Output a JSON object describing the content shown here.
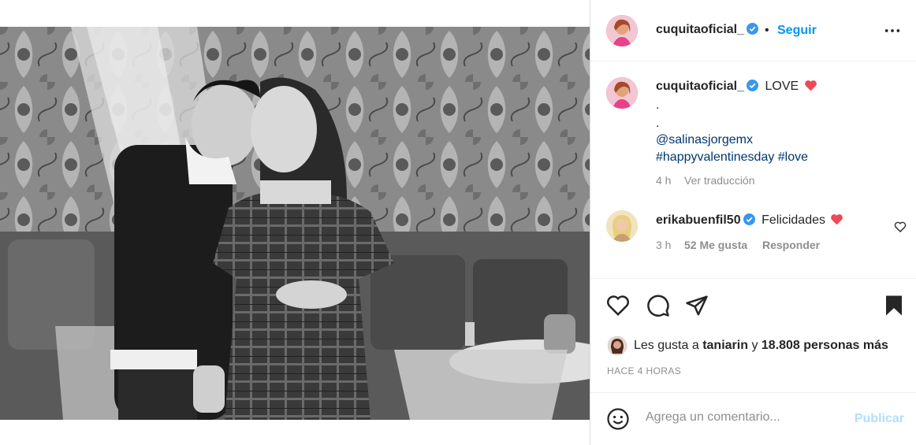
{
  "post": {
    "author": "cuquitaoficial_",
    "separator": "•",
    "follow_label": "Seguir",
    "more_icon": "more-options-icon"
  },
  "caption": {
    "author": "cuquitaoficial_",
    "text": "LOVE",
    "dot1": ".",
    "dot2": ".",
    "mention": "@salinasjorgemx",
    "hashtags": "#happyvalentinesday #love",
    "time": "4 h",
    "translate_label": "Ver traducción"
  },
  "comment": {
    "author": "erikabuenfil50",
    "text": "Felicidades",
    "time": "3 h",
    "likes": "52 Me gusta",
    "reply_label": "Responder"
  },
  "likes": {
    "prefix": "Les gusta a",
    "user": "taniarin",
    "connector": "y",
    "others": "18.808 personas más"
  },
  "timestamp": "HACE 4 HORAS",
  "add_comment": {
    "placeholder": "Agrega un comentario...",
    "publish_label": "Publicar"
  },
  "colors": {
    "accent": "#0095f6",
    "heart": "#ed4956",
    "publish_disabled": "#b2dffc",
    "muted": "#8e8e8e"
  }
}
